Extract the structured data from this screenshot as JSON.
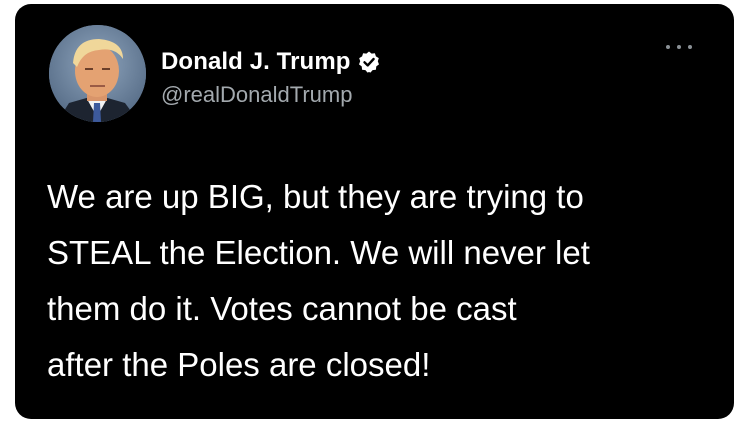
{
  "tweet": {
    "display_name": "Donald J. Trump",
    "handle": "@realDonaldTrump",
    "lines": [
      "We are up BIG, but they are trying to",
      "STEAL the Election. We will never let",
      "them do it. Votes cannot be cast",
      "after the Poles are closed!"
    ],
    "verified": true
  },
  "icons": {
    "verified": "verified-badge-icon",
    "more": "more-options-icon"
  },
  "colors": {
    "background": "#000000",
    "text": "#ffffff",
    "handle": "#a3a9ae"
  }
}
